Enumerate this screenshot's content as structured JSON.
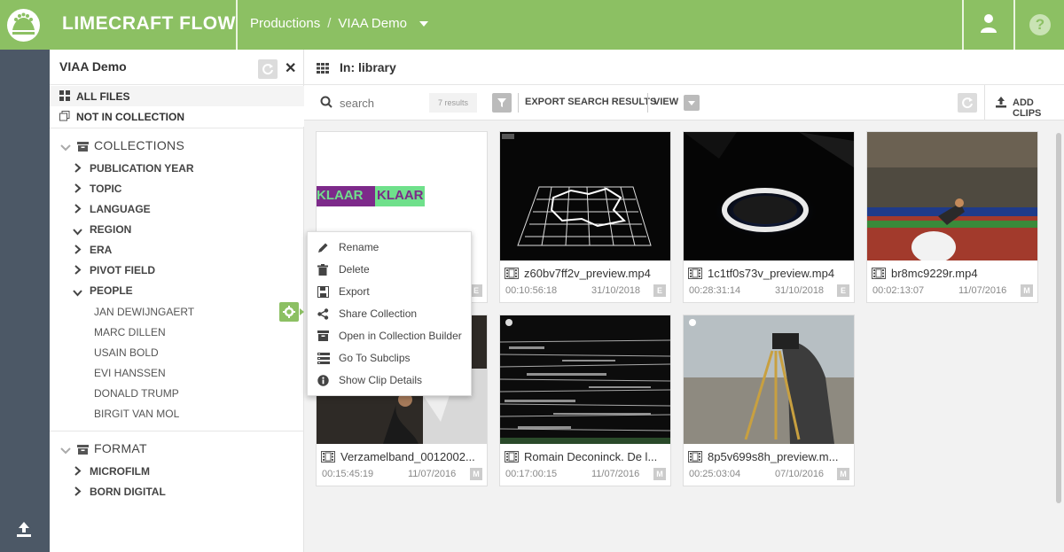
{
  "app": {
    "brand": "LIMECRAFT FLOW"
  },
  "breadcrumb": {
    "productions": "Productions",
    "separator": "/",
    "current": "VIAA Demo"
  },
  "sidebar": {
    "title": "VIAA Demo",
    "filters": [
      {
        "label": "ALL FILES",
        "icon": "grid-icon"
      },
      {
        "label": "NOT IN COLLECTION",
        "icon": "copy-icon"
      }
    ],
    "collections": {
      "label": "COLLECTIONS",
      "items": [
        {
          "label": "PUBLICATION YEAR",
          "state": "collapsed"
        },
        {
          "label": "TOPIC",
          "state": "collapsed"
        },
        {
          "label": "LANGUAGE",
          "state": "collapsed"
        },
        {
          "label": "REGION",
          "state": "expanded"
        },
        {
          "label": "ERA",
          "state": "collapsed"
        },
        {
          "label": "PIVOT FIELD",
          "state": "collapsed"
        },
        {
          "label": "PEOPLE",
          "state": "expanded"
        }
      ],
      "people": [
        "JAN DEWIJNGAERT",
        "MARC DILLEN",
        "USAIN BOLD",
        "EVI HANSSEN",
        "DONALD TRUMP",
        "BIRGIT VAN MOL"
      ]
    },
    "format": {
      "label": "FORMAT",
      "items": [
        "MICROFILM",
        "BORN DIGITAL"
      ]
    }
  },
  "main": {
    "location": "In: library",
    "search": {
      "placeholder": "search",
      "results": "7 results"
    },
    "toolbar": {
      "export": "EXPORT SEARCH RESULTS",
      "view": "VIEW",
      "add_clips": "ADD CLIPS"
    }
  },
  "clips": [
    {
      "name": "",
      "duration": "",
      "date": "",
      "badge": "E",
      "thumb": "klaar"
    },
    {
      "name": "z60bv7ff2v_preview.mp4",
      "duration": "00:10:56:18",
      "date": "31/10/2018",
      "badge": "E",
      "thumb": "map-grid"
    },
    {
      "name": "1c1tf0s73v_preview.mp4",
      "duration": "00:28:31:14",
      "date": "31/10/2018",
      "badge": "E",
      "thumb": "studio-ring"
    },
    {
      "name": "br8mc9229r.mp4",
      "duration": "00:02:13:07",
      "date": "11/07/2016",
      "badge": "M",
      "thumb": "stadium"
    },
    {
      "name": "Verzamelband_0012002...",
      "duration": "00:15:45:19",
      "date": "11/07/2016",
      "badge": "M",
      "thumb": "interior"
    },
    {
      "name": "Romain Deconinck. De l...",
      "duration": "00:17:00:15",
      "date": "11/07/2016",
      "badge": "M",
      "thumb": "noise"
    },
    {
      "name": "8p5v699s8h_preview.m...",
      "duration": "00:25:03:04",
      "date": "07/10/2016",
      "badge": "M",
      "thumb": "camera-operator"
    }
  ],
  "context_menu": {
    "items": [
      {
        "label": "Rename",
        "icon": "pencil-icon"
      },
      {
        "label": "Delete",
        "icon": "trash-icon"
      },
      {
        "label": "Export",
        "icon": "save-icon"
      },
      {
        "label": "Share Collection",
        "icon": "share-icon"
      },
      {
        "label": "Open in Collection Builder",
        "icon": "archive-icon"
      },
      {
        "label": "Go To Subclips",
        "icon": "list-icon"
      },
      {
        "label": "Show Clip Details",
        "icon": "info-icon"
      }
    ]
  },
  "colors": {
    "brand_green": "#8cc063",
    "rail": "#4c5866"
  }
}
